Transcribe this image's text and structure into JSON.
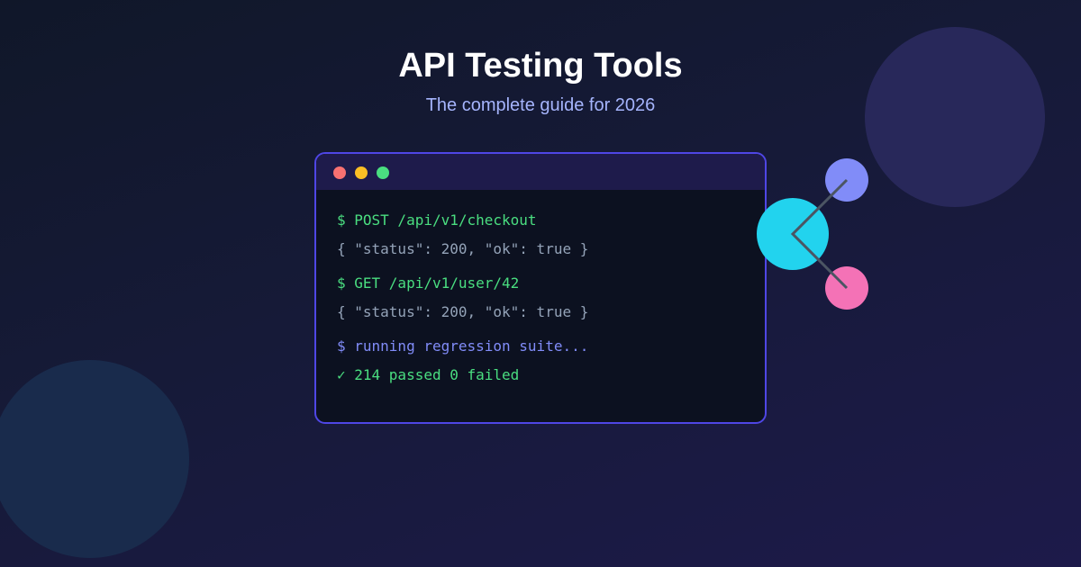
{
  "header": {
    "title": "API Testing Tools",
    "subtitle": "The complete guide for 2026"
  },
  "terminal": {
    "window_dots": [
      "red",
      "yellow",
      "green"
    ],
    "lines": [
      "$ POST /api/v1/checkout",
      "{ \"status\": 200, \"ok\": true }",
      "$ GET /api/v1/user/42",
      "{ \"status\": 200, \"ok\": true }",
      "$ running regression suite...",
      "✓ 214 passed 0 failed"
    ]
  },
  "colors": {
    "background": "#161a38",
    "accent": "#4f46e5",
    "terminal_bg": "#0c1120",
    "terminal_header": "#1e1b4b",
    "command_green": "#4ade80",
    "response_gray": "#94a3b8",
    "info_purple": "#818cf8",
    "dot_red": "#f87171",
    "dot_yellow": "#fbbf24",
    "dot_green": "#4ade80",
    "node_cyan": "#22d3ee",
    "node_indigo": "#818cf8",
    "node_pink": "#f472b6"
  },
  "illustration": {
    "type": "network-nodes",
    "nodes": [
      "cyan",
      "indigo",
      "pink"
    ]
  }
}
